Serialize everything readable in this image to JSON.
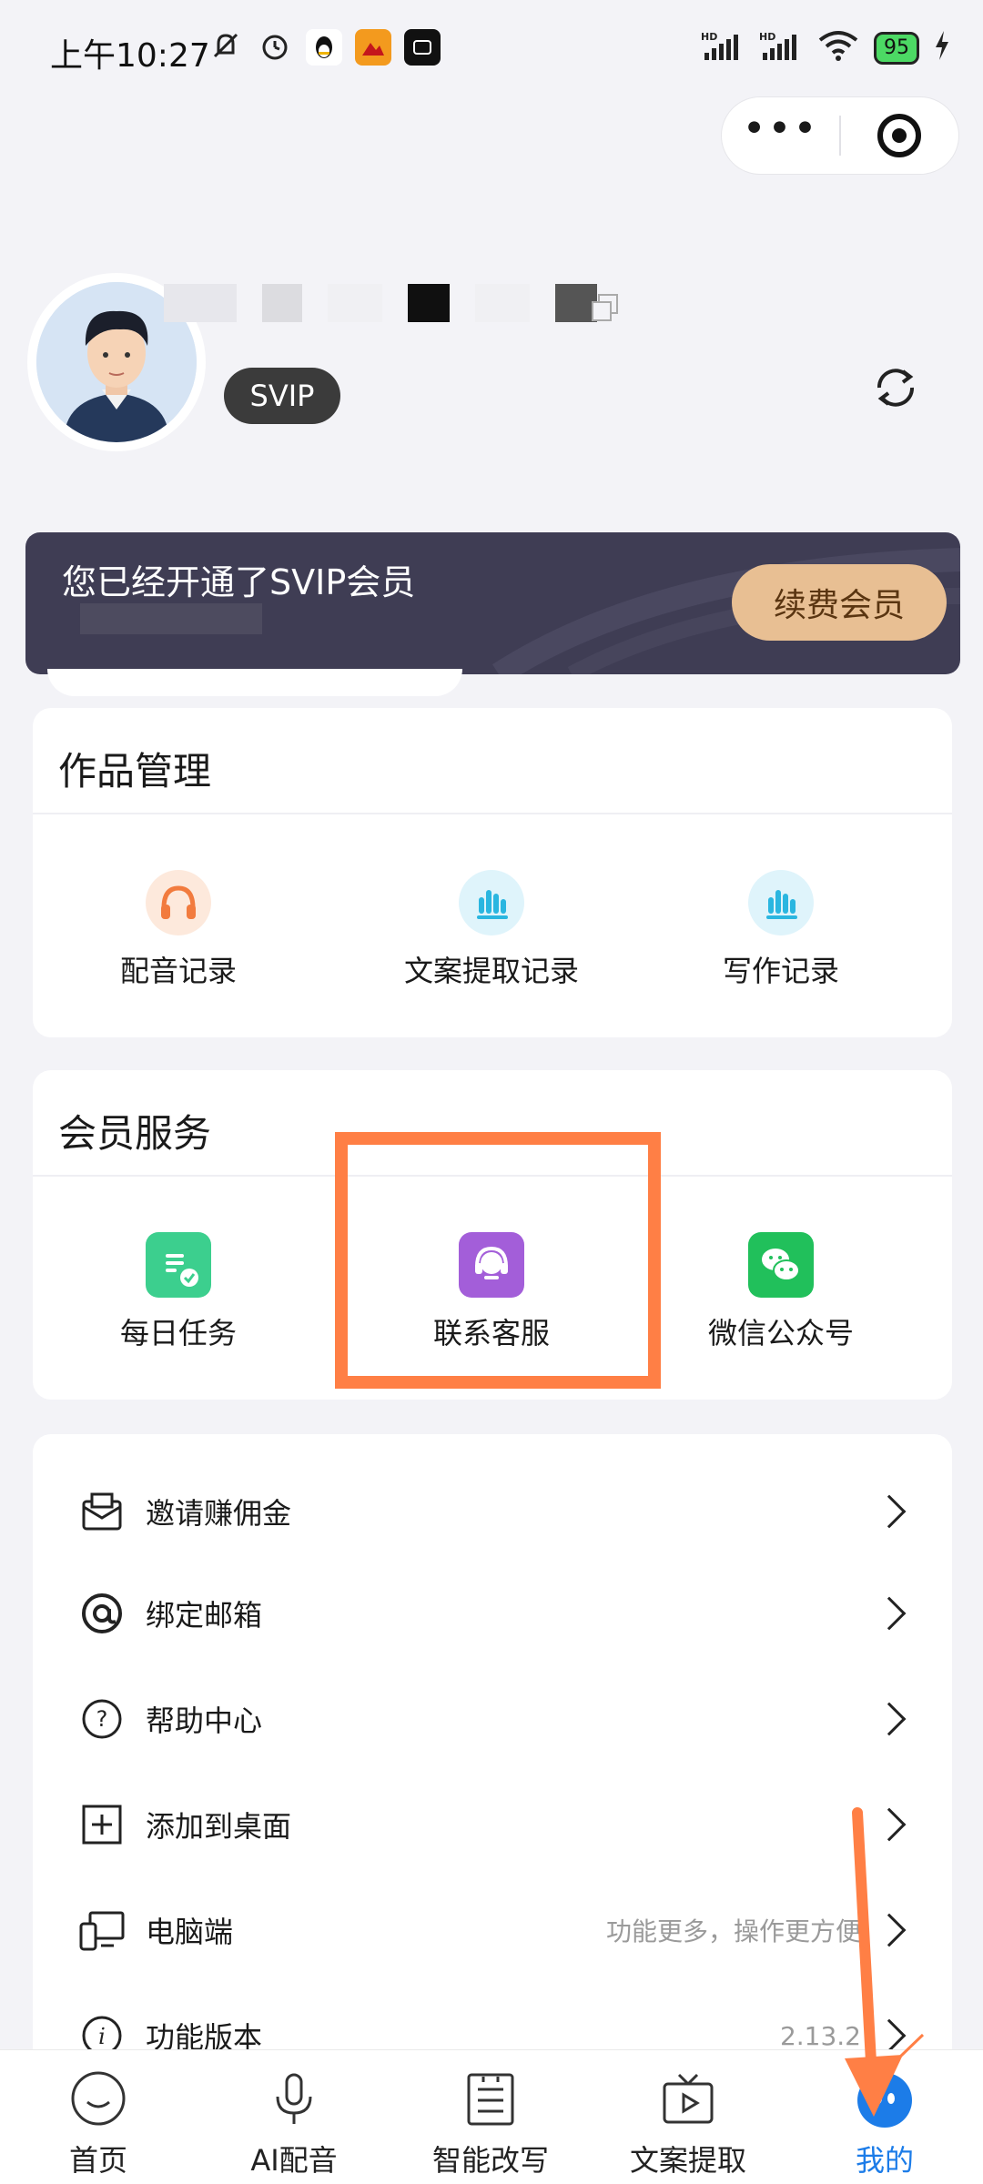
{
  "status_bar": {
    "time": "上午10:27",
    "battery": "95",
    "signal1": "HD",
    "signal2": "HD"
  },
  "profile": {
    "badge": "SVIP"
  },
  "banner": {
    "title": "您已经开通了SVIP会员",
    "renew_button": "续费会员"
  },
  "works": {
    "title": "作品管理",
    "items": [
      {
        "label": "配音记录",
        "icon": "headphones-icon"
      },
      {
        "label": "文案提取记录",
        "icon": "audio-bars-icon"
      },
      {
        "label": "写作记录",
        "icon": "audio-bars-icon"
      }
    ]
  },
  "member": {
    "title": "会员服务",
    "items": [
      {
        "label": "每日任务",
        "icon": "task-icon"
      },
      {
        "label": "联系客服",
        "icon": "headset-icon"
      },
      {
        "label": "微信公众号",
        "icon": "wechat-icon"
      }
    ]
  },
  "menu": {
    "items": [
      {
        "label": "邀请赚佣金",
        "icon": "envelope-icon"
      },
      {
        "label": "绑定邮箱",
        "icon": "at-icon"
      },
      {
        "label": "帮助中心",
        "icon": "help-icon"
      },
      {
        "label": "添加到桌面",
        "icon": "plus-box-icon"
      },
      {
        "label": "电脑端",
        "icon": "devices-icon",
        "sub": "功能更多，操作更方便"
      },
      {
        "label": "功能版本",
        "icon": "info-icon",
        "sub": "2.13.2"
      }
    ]
  },
  "tabbar": {
    "items": [
      {
        "label": "首页",
        "icon": "home-smile-icon"
      },
      {
        "label": "AI配音",
        "icon": "microphone-icon"
      },
      {
        "label": "智能改写",
        "icon": "document-icon"
      },
      {
        "label": "文案提取",
        "icon": "tv-play-icon"
      },
      {
        "label": "我的",
        "icon": "profile-face-icon"
      }
    ],
    "active": "我的"
  },
  "colors": {
    "accent": "#1c7ce8",
    "highlight": "#ff7f45",
    "banner_bg": "#3f3d54",
    "renew_bg": "#e8bf93"
  }
}
